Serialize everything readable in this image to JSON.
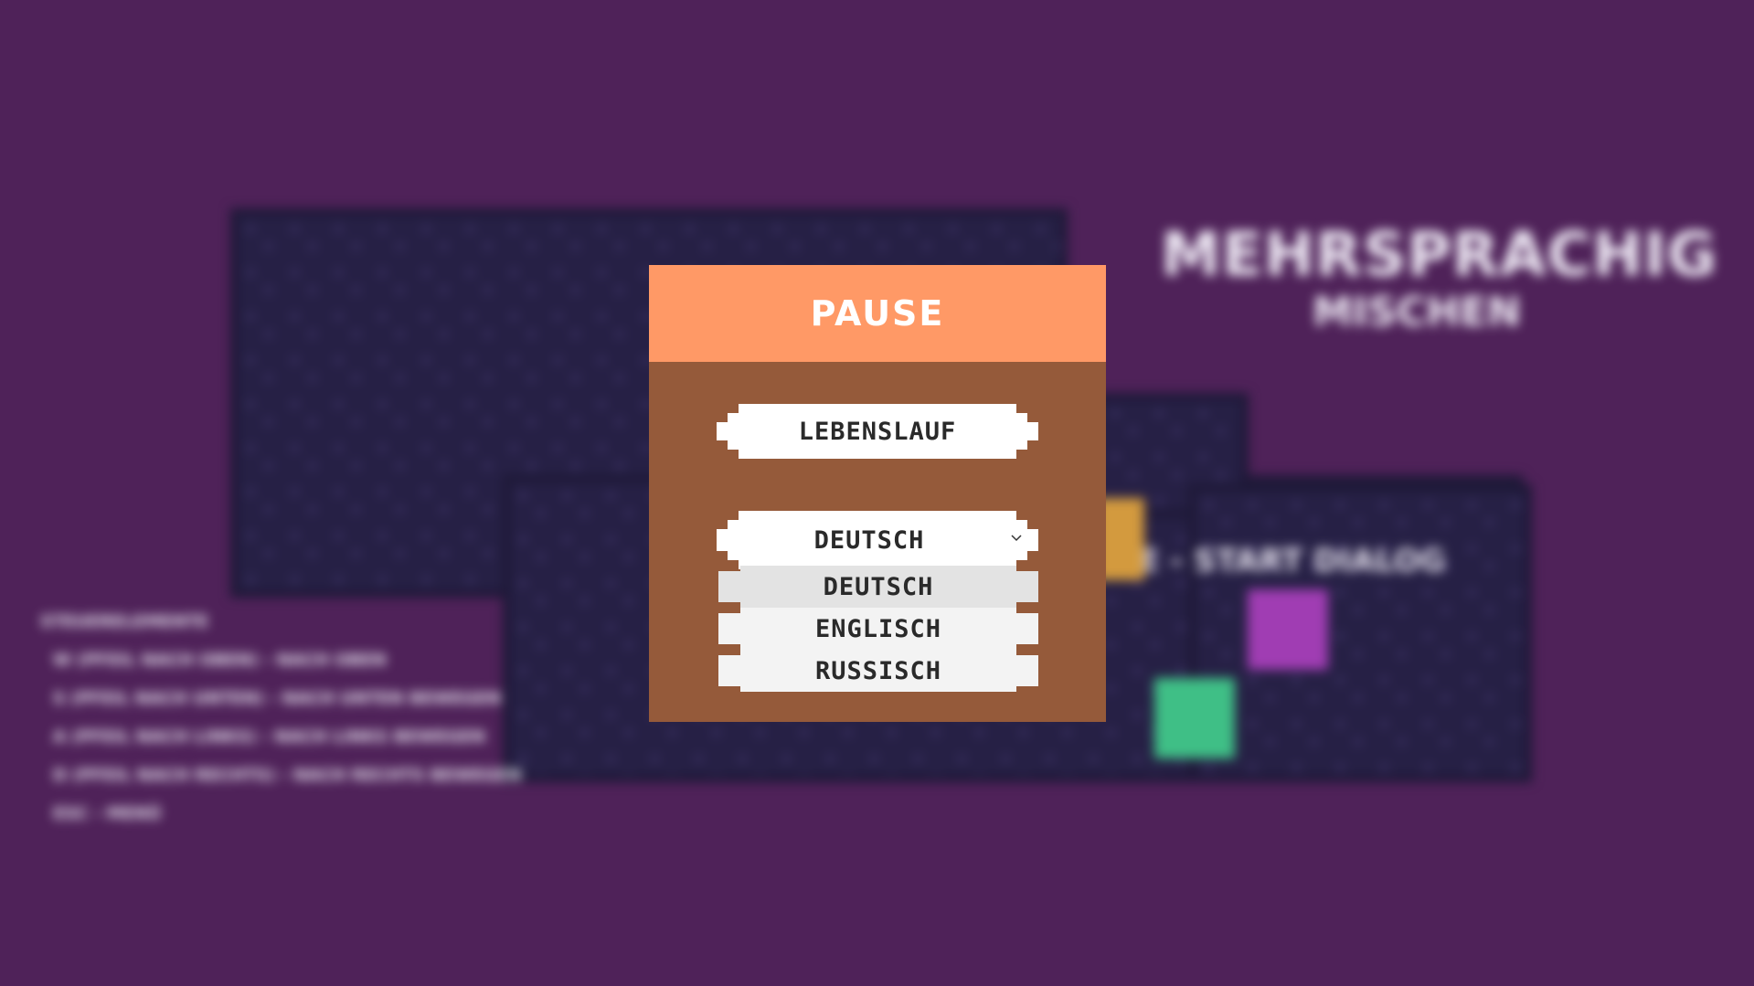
{
  "scene": {
    "title": "MEHRSPRACHIG",
    "subtitle": "MISCHEN",
    "hint": "E - START DIALOG",
    "controls": {
      "heading": "STEUERELEMENTE",
      "lines": [
        "W (PFEIL NACH OBEN) - NACH OBEN",
        "S (PFEIL NACH UNTEN) - NACH UNTEN BEWEGEN",
        "A (PFEIL NACH LINKS) - NACH LINKS BEWEGEN",
        "D (PFEIL NACH RECHTS) - NACH RECHTS BEWEGEN",
        "ESC - MENÜ"
      ]
    },
    "colors": {
      "background": "#4f2259",
      "tiles": "#262045",
      "character_orange": "#d39a3e",
      "character_purple": "#a03db3",
      "character_green": "#3fbf86"
    }
  },
  "pause_menu": {
    "title": "PAUSE",
    "resume_label": "LEBENSLAUF",
    "language_select": {
      "selected": "DEUTSCH",
      "icon": "chevron-down-icon",
      "options": [
        "DEUTSCH",
        "ENGLISCH",
        "RUSSISCH"
      ]
    },
    "colors": {
      "header": "#ff9966",
      "panel": "#955a3a",
      "button": "#ffffff"
    }
  }
}
